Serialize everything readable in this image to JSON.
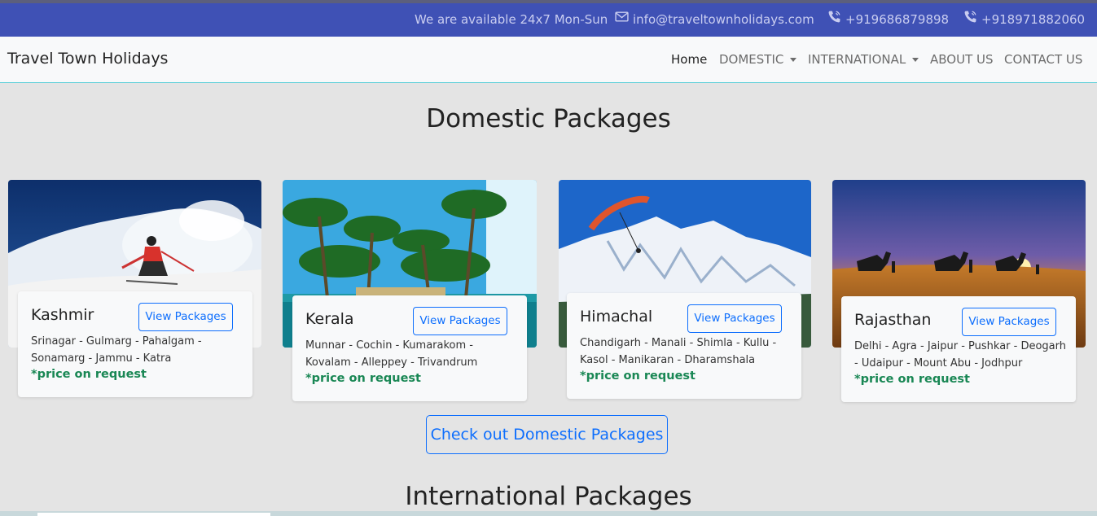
{
  "topbar": {
    "availability": "We are available 24x7 Mon-Sun",
    "email": "info@traveltownholidays.com",
    "phone1": "+919686879898",
    "phone2": "+918971882060",
    "email_icon": "envelope-icon",
    "phone_icon": "phone-icon"
  },
  "nav": {
    "brand": "Travel Town Holidays",
    "home": "Home",
    "domestic": "DOMESTIC",
    "international": "INTERNATIONAL",
    "about": "ABOUT US",
    "contact": "CONTACT US"
  },
  "domestic": {
    "title": "Domestic Packages",
    "cta": "Check out Domestic Packages",
    "packages": [
      {
        "name": "Kashmir",
        "button": "View Packages",
        "places": "Srinagar - Gulmarg - Pahalgam - Sonamarg - Jammu - Katra",
        "price": "*price on request"
      },
      {
        "name": "Kerala",
        "button": "View Packages",
        "places": "Munnar - Cochin - Kumarakom - Kovalam - Alleppey - Trivandrum",
        "price": "*price on request"
      },
      {
        "name": "Himachal",
        "button": "View Packages",
        "places": "Chandigarh - Manali - Shimla - Kullu - Kasol - Manikaran - Dharamshala",
        "price": "*price on request"
      },
      {
        "name": "Rajasthan",
        "button": "View Packages",
        "places": "Delhi - Agra - Jaipur - Pushkar - Deogarh - Udaipur - Mount Abu - Jodhpur",
        "price": "*price on request"
      }
    ]
  },
  "international": {
    "title": "International Packages"
  },
  "colors": {
    "topbar": "#3f51b5",
    "accent": "#0d6efd",
    "price": "#198754"
  }
}
